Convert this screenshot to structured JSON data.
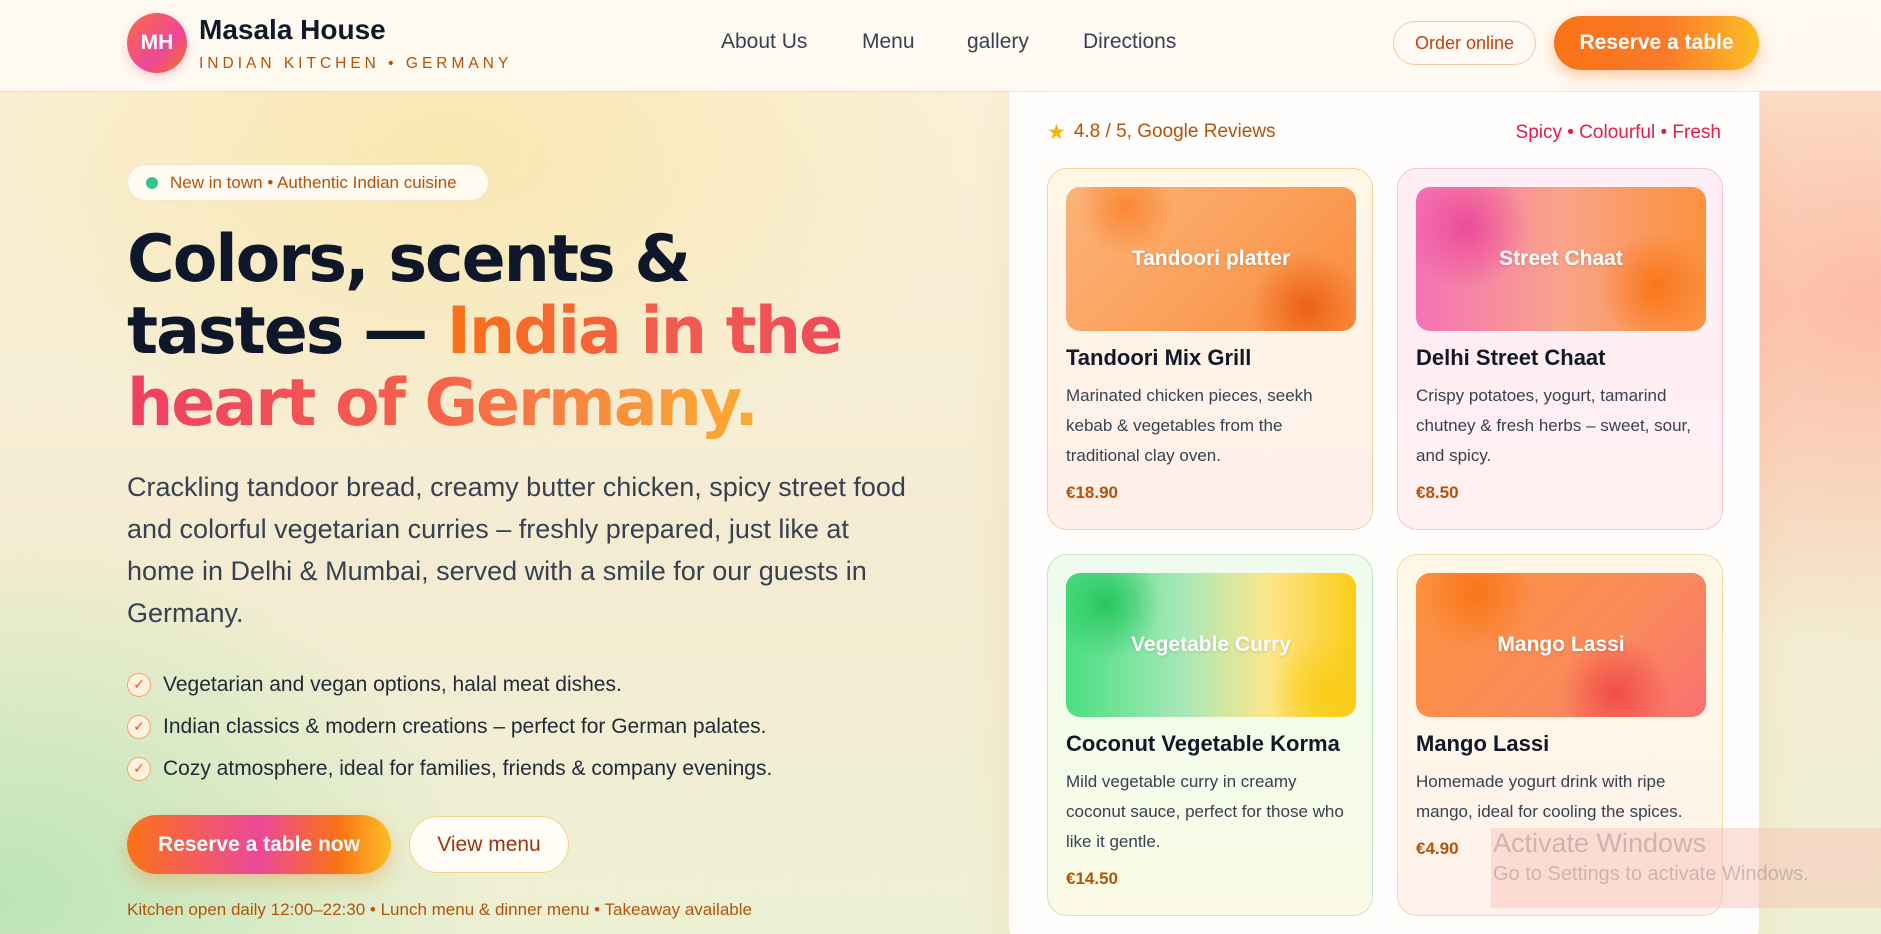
{
  "header": {
    "logo_initials": "MH",
    "brand_name": "Masala House",
    "brand_tagline": "INDIAN KITCHEN • GERMANY",
    "nav": [
      "About Us",
      "Menu",
      "gallery",
      "Directions"
    ],
    "order_online": "Order online",
    "reserve_table": "Reserve a table"
  },
  "hero": {
    "pill": "New in town • Authentic Indian cuisine",
    "headline_line1": "Colors, scents &",
    "headline_line2_plain": "tastes — ",
    "headline_line2_accent": "India in the",
    "headline_line3": "heart of Germany.",
    "lead": "Crackling tandoor bread, creamy butter chicken, spicy street food and colorful vegetarian curries – freshly prepared, just like at home in Delhi & Mumbai, served with a smile for our guests in Germany.",
    "features": [
      "Vegetarian and vegan options, halal meat dishes.",
      "Indian classics & modern creations – perfect for German palates.",
      "Cozy atmosphere, ideal for families, friends & company evenings."
    ],
    "cta_primary": "Reserve a table now",
    "cta_secondary": "View menu",
    "hours": "Kitchen open daily 12:00–22:30 • Lunch menu & dinner menu • Takeaway available"
  },
  "panel": {
    "rating": "4.8 / 5, Google Reviews",
    "tagline": "Spicy • Colourful • Fresh",
    "cards": [
      {
        "image_label": "Tandoori platter",
        "title": "Tandoori Mix Grill",
        "description": "Marinated chicken pieces, seekh kebab & vegetables from the traditional clay oven.",
        "price": "€18.90"
      },
      {
        "image_label": "Street Chaat",
        "title": "Delhi Street Chaat",
        "description": "Crispy potatoes, yogurt, tamarind chutney & fresh herbs – sweet, sour, and spicy.",
        "price": "€8.50"
      },
      {
        "image_label": "Vegetable Curry",
        "title": "Coconut Vegetable Korma",
        "description": "Mild vegetable curry in creamy coconut sauce, perfect for those who like it gentle.",
        "price": "€14.50"
      },
      {
        "image_label": "Mango Lassi",
        "title": "Mango Lassi",
        "description": "Homemade yogurt drink with ripe mango, ideal for cooling the spices.",
        "price": "€4.90"
      }
    ]
  },
  "watermark": {
    "line1": "Activate Windows",
    "line2": "Go to Settings to activate Windows."
  },
  "colors": {
    "accent_orange": "#f97316",
    "accent_pink": "#ec4899",
    "accent_gold": "#fbbf24",
    "text_dark": "#0f172a"
  }
}
